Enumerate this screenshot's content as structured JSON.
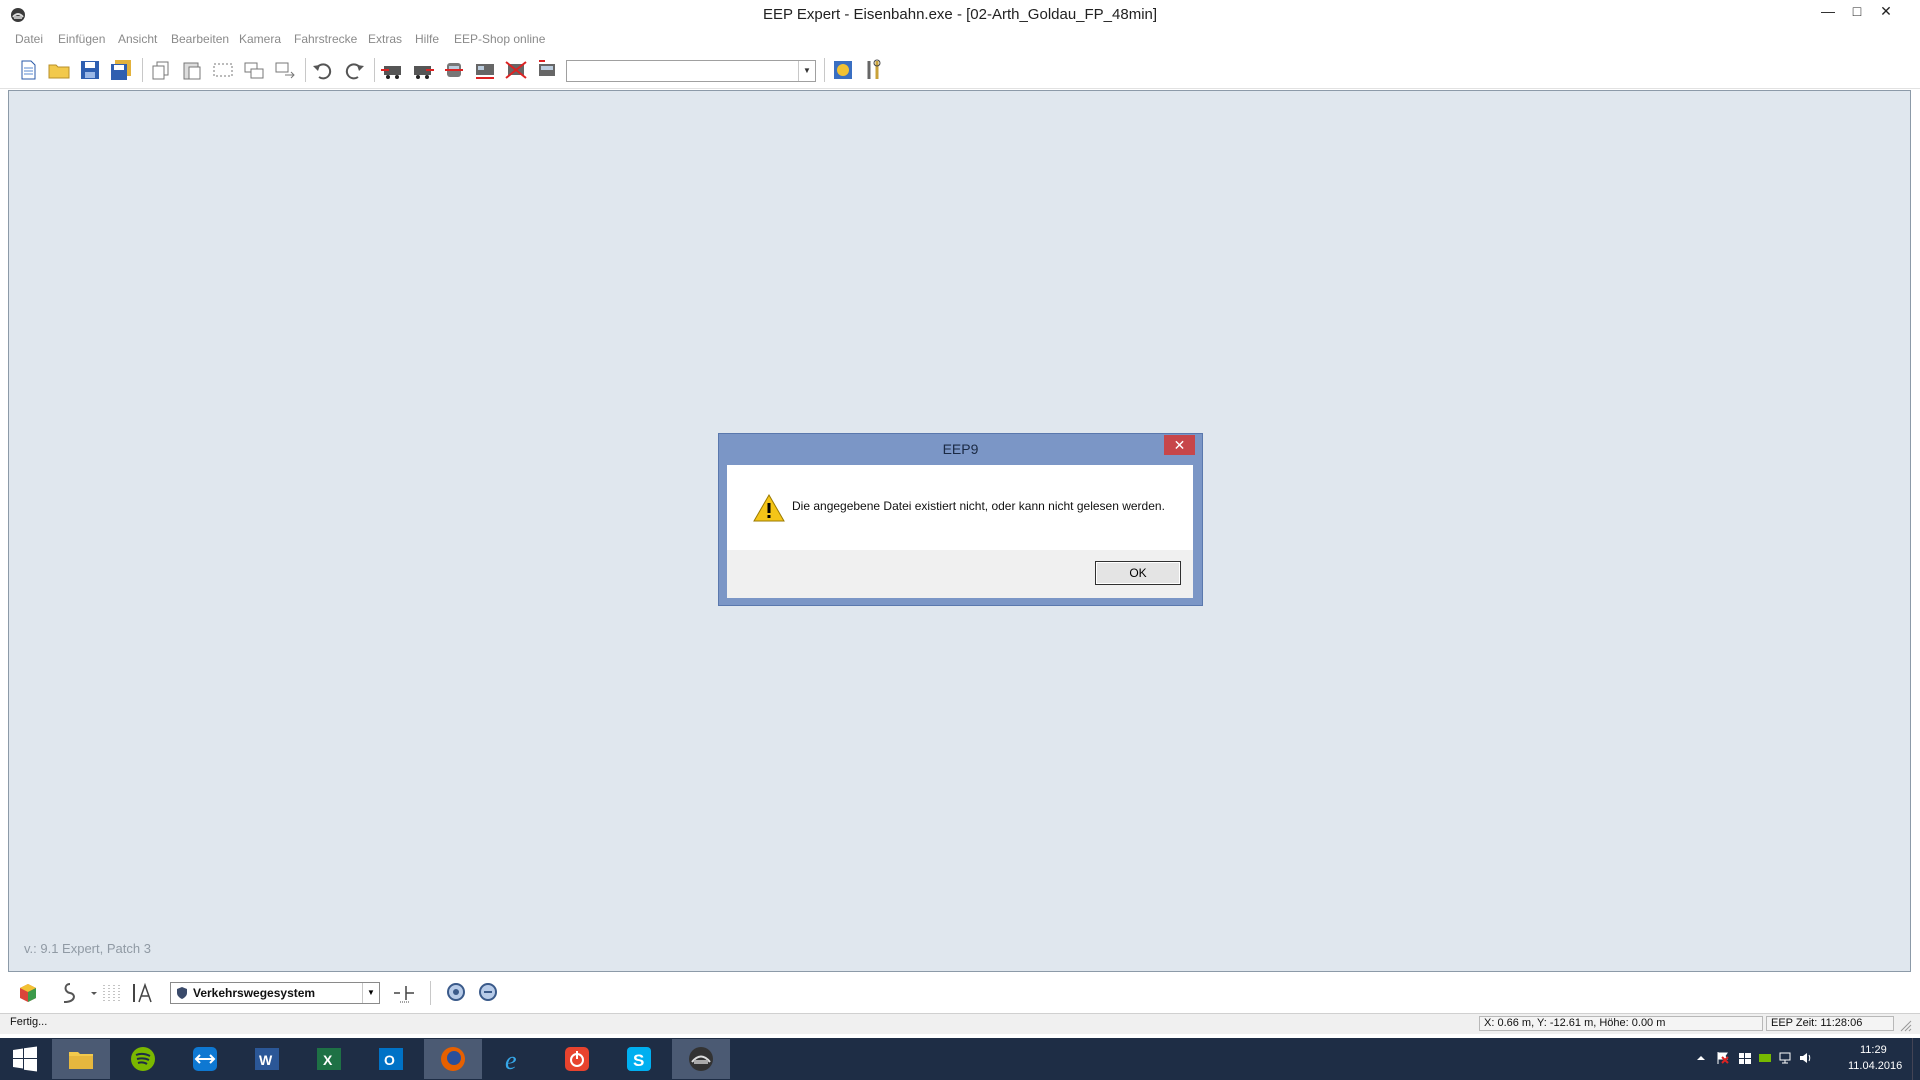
{
  "window": {
    "title": "EEP Expert - Eisenbahn.exe - [02-Arth_Goldau_FP_48min]",
    "controls": {
      "minimize": "—",
      "maximize": "□",
      "close": "✕"
    }
  },
  "menu": {
    "items": [
      "Datei",
      "Einfügen",
      "Ansicht",
      "Bearbeiten",
      "Kamera",
      "Fahrstrecke",
      "Extras",
      "Hilfe",
      "EEP-Shop online"
    ]
  },
  "toolbar": {
    "icons": [
      "new-file-icon",
      "open-folder-icon",
      "save-icon",
      "save-all-icon",
      "copy-icon",
      "paste-icon",
      "select-rect-icon",
      "duplicate-icon",
      "move-icon",
      "undo-icon",
      "redo-icon",
      "train-left-icon",
      "train-right-icon",
      "train-front-icon",
      "train-couple-icon",
      "train-decouple-icon",
      "train-list-icon",
      "world-settings-icon",
      "tools-icon"
    ],
    "combo_value": ""
  },
  "workspace": {
    "background": "#e0e7ee",
    "version": "v.: 9.1 Expert, Patch 3"
  },
  "dialog": {
    "title": "EEP9",
    "message": "Die angegebene Datei existiert nicht, oder kann nicht gelesen werden.",
    "ok_label": "OK",
    "close_label": "✕",
    "icon": "warning-icon"
  },
  "bottom_toolbar": {
    "layer_select": "Verkehrswegesystem"
  },
  "statusbar": {
    "left": "Fertig...",
    "coords": "X: 0.66 m, Y: -12.61 m, Höhe: 0.00 m",
    "time": "EEP Zeit: 11:28:06"
  },
  "taskbar": {
    "apps": [
      "start-icon",
      "file-explorer-icon",
      "spotify-icon",
      "teamviewer-icon",
      "word-icon",
      "excel-icon",
      "outlook-icon",
      "firefox-icon",
      "internet-explorer-icon",
      "power-app-icon",
      "skype-icon",
      "eep-icon"
    ],
    "clock_time": "11:29",
    "clock_date": "11.04.2016"
  }
}
